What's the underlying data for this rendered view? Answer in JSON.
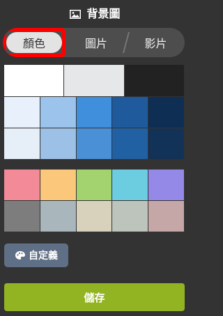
{
  "header": {
    "title": "背景圖"
  },
  "tabs": {
    "color": "顏色",
    "image": "圖片",
    "video": "影片"
  },
  "colors": {
    "neutral": [
      "#ffffff",
      "#e6e7e9",
      "#222222"
    ],
    "blues_row1": [
      "#e8f1fb",
      "#9cc3eb",
      "#3f8fdc",
      "#1e5a9c",
      "#0f2e54"
    ],
    "blues_row2": [
      "#e6eef8",
      "#9dc0e6",
      "#4a90d6",
      "#2160a3",
      "#133257"
    ],
    "bright_row": [
      "#f38a98",
      "#fbc77a",
      "#a3d36f",
      "#6ccce0",
      "#9489e6"
    ],
    "muted_row": [
      "#7d7d7d",
      "#a9b6bc",
      "#d8d2bc",
      "#bcc4bc",
      "#c5a7a8"
    ]
  },
  "buttons": {
    "custom": "自定義",
    "save": "儲存"
  }
}
